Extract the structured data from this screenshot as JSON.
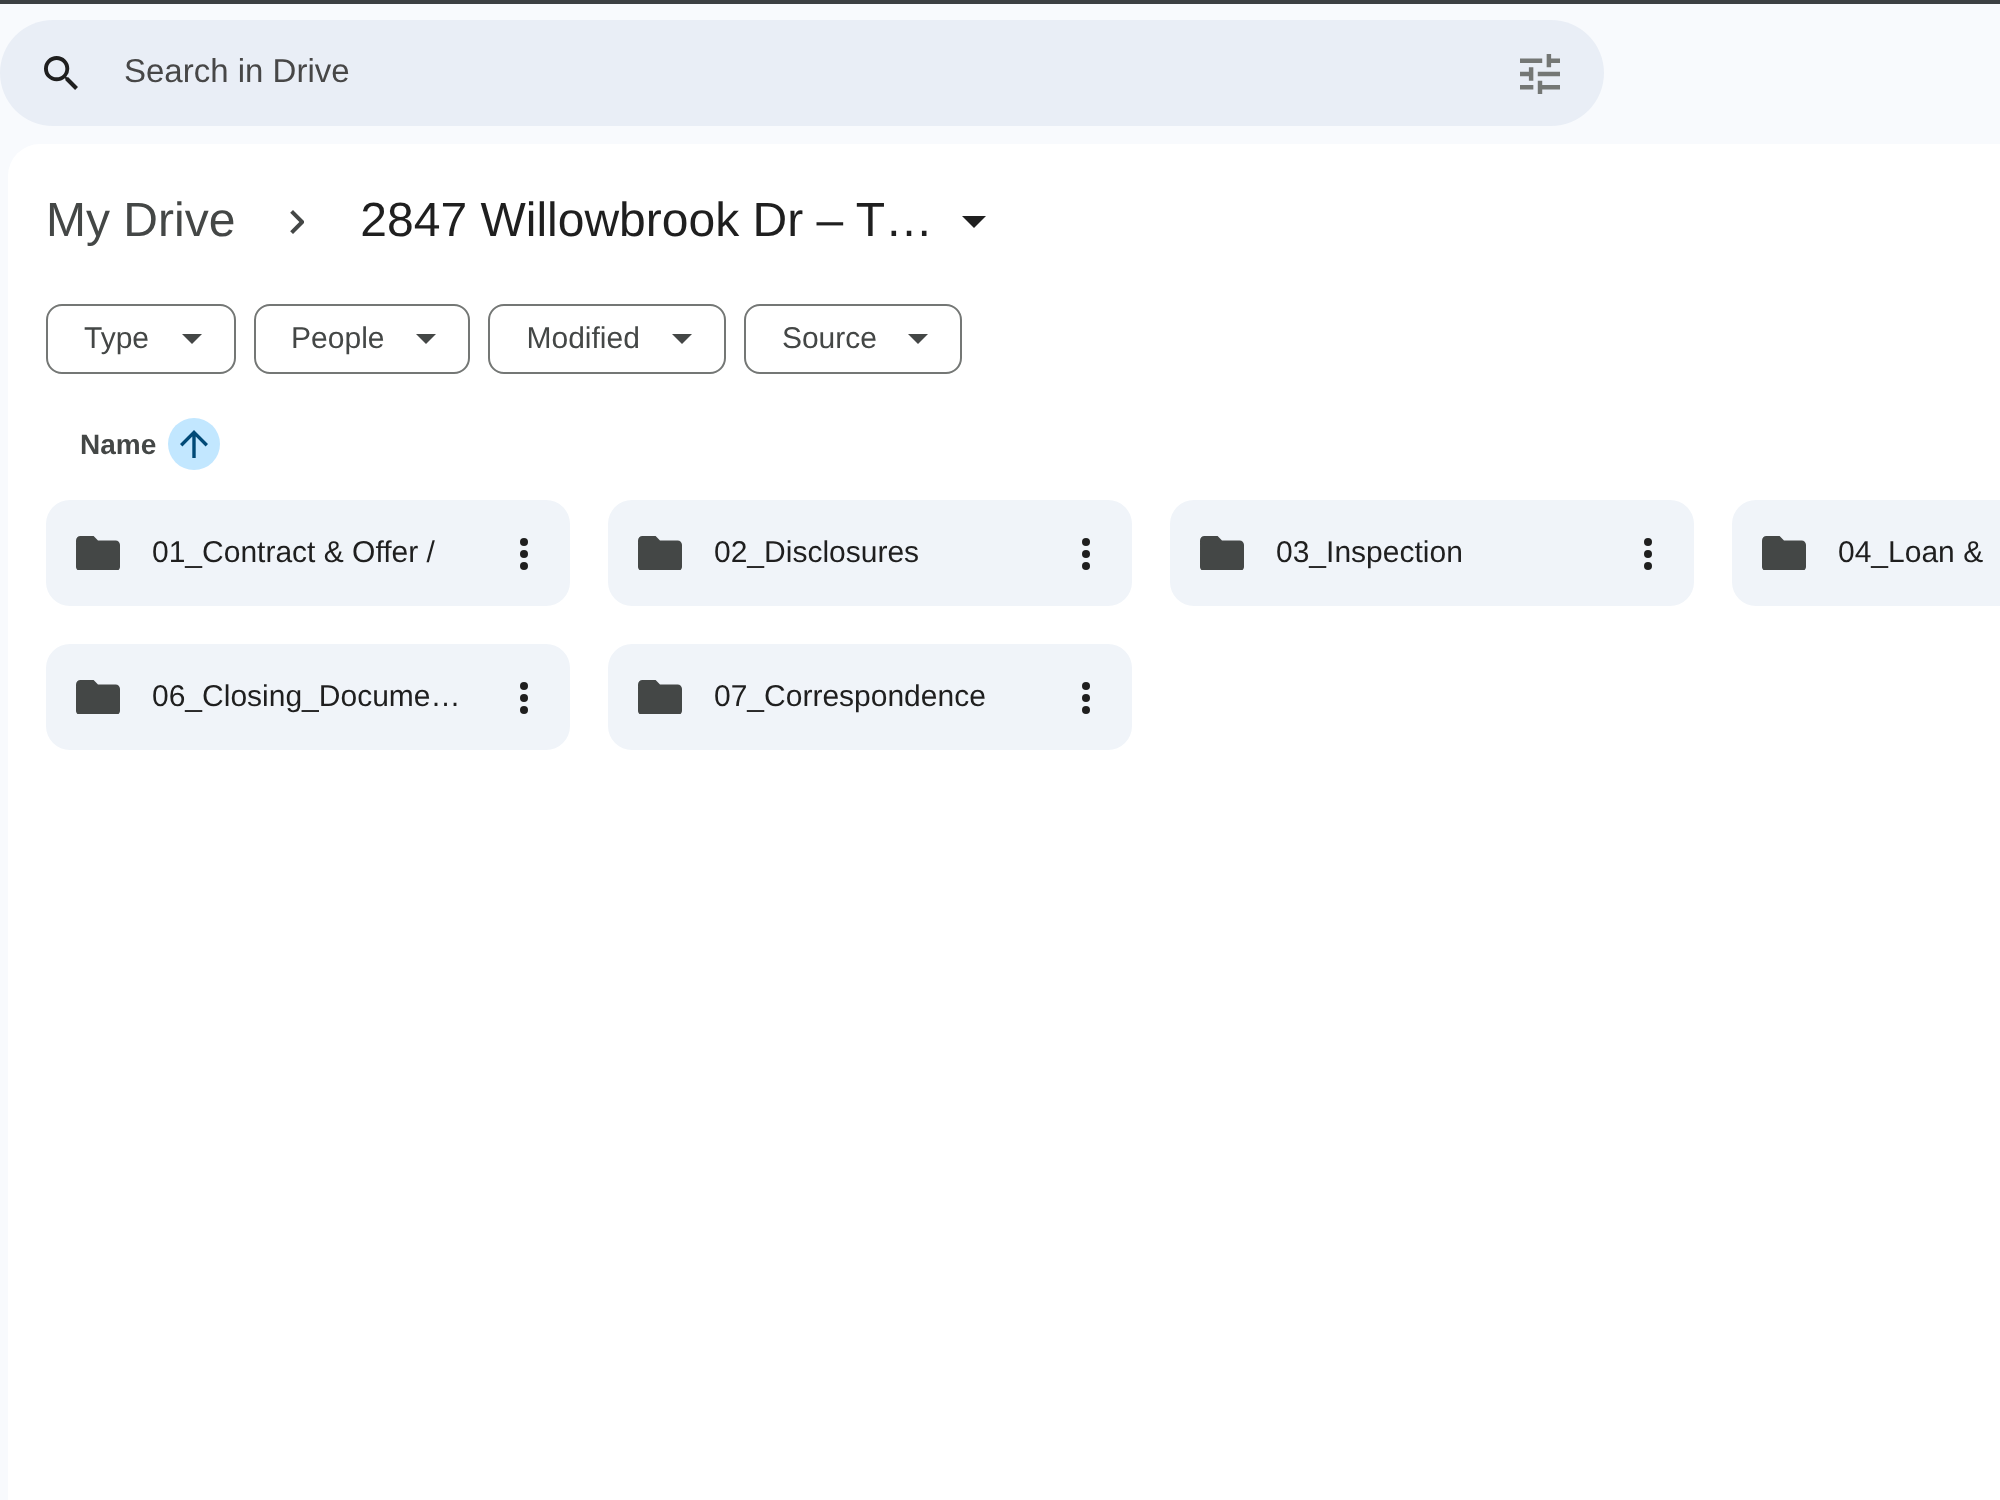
{
  "search": {
    "placeholder": "Search in Drive"
  },
  "breadcrumb": [
    {
      "label": "My Drive",
      "current": false
    },
    {
      "label": "2847 Willowbrook Dr – T…",
      "current": true
    }
  ],
  "filters": [
    "Type",
    "People",
    "Modified",
    "Source"
  ],
  "sort": {
    "label": "Name",
    "ascending": true
  },
  "folders": [
    {
      "name": "01_Contract & Offer /"
    },
    {
      "name": "02_Disclosures"
    },
    {
      "name": "03_Inspection"
    },
    {
      "name": "04_Loan &"
    },
    {
      "name": "06_Closing_Docume…"
    },
    {
      "name": "07_Correspondence"
    }
  ]
}
